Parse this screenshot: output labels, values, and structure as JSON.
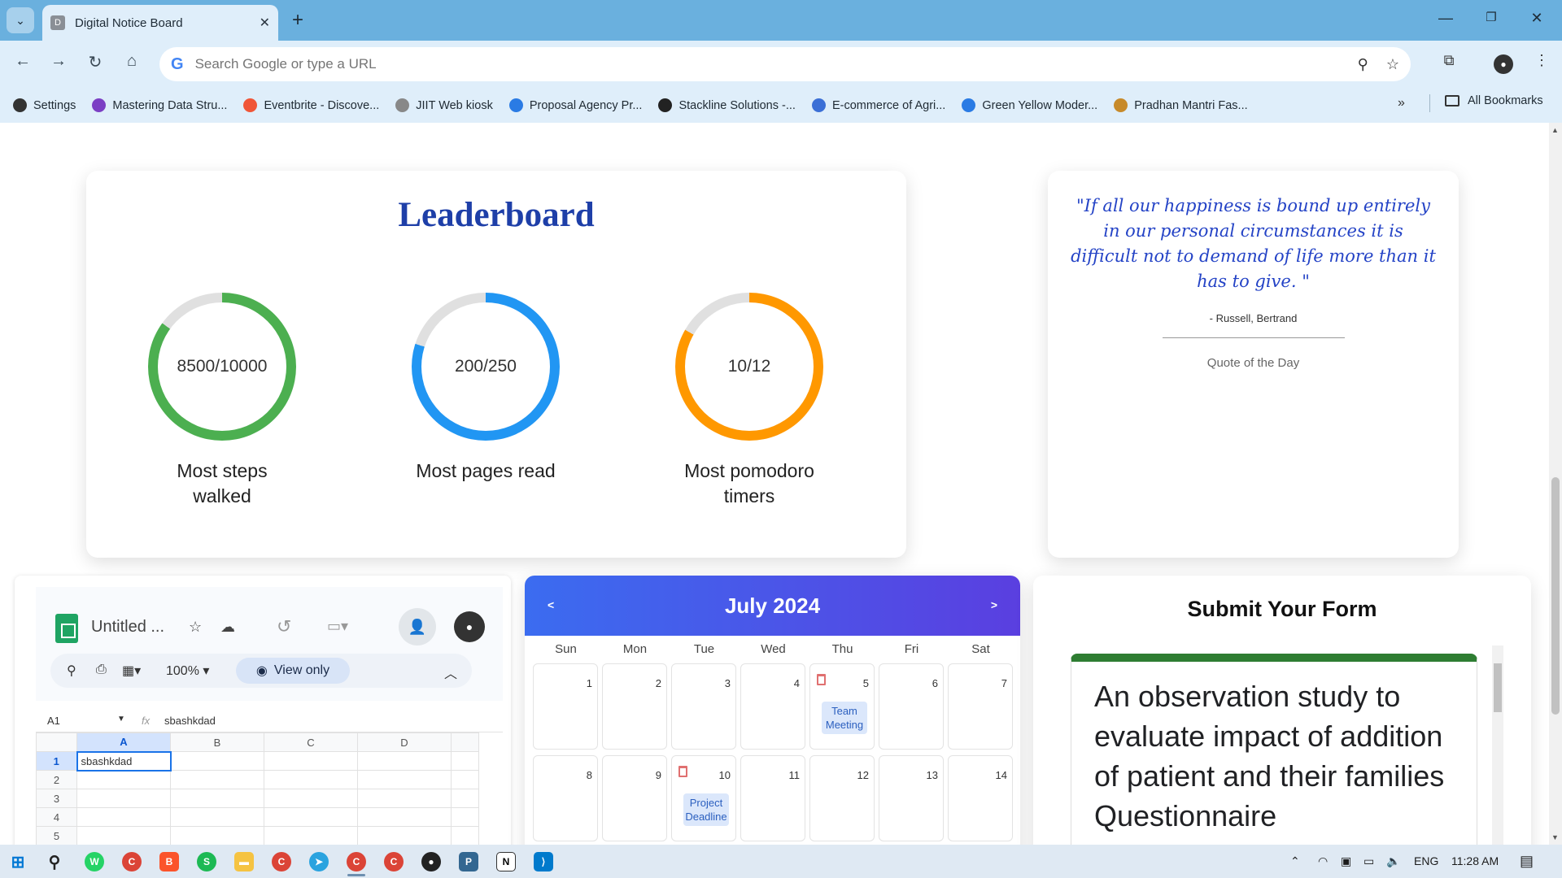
{
  "browser": {
    "tab_title": "Digital Notice Board",
    "tab_favicon": "D",
    "address_placeholder": "Search Google or type a URL",
    "bookmarks": [
      {
        "label": "Settings",
        "icon": "gear-icon",
        "color": "#333333"
      },
      {
        "label": "Mastering Data Stru...",
        "icon": "bookmark-icon",
        "color": "#7b3fc4"
      },
      {
        "label": "Eventbrite - Discove...",
        "icon": "eventbrite-icon",
        "color": "#f05537"
      },
      {
        "label": "JIIT Web kiosk",
        "icon": "kiosk-icon",
        "color": "#888888"
      },
      {
        "label": "Proposal Agency Pr...",
        "icon": "canva-icon",
        "color": "#2a7be4"
      },
      {
        "label": "Stackline Solutions -...",
        "icon": "s-icon",
        "color": "#222222"
      },
      {
        "label": "E-commerce of Agri...",
        "icon": "triangle-icon",
        "color": "#3b6fd6"
      },
      {
        "label": "Green Yellow Moder...",
        "icon": "canva-icon",
        "color": "#2a7be4"
      },
      {
        "label": "Pradhan Mantri Fas...",
        "icon": "emblem-icon",
        "color": "#c78a2a"
      }
    ],
    "all_bookmarks": "All Bookmarks"
  },
  "leaderboard": {
    "title": "Leaderboard",
    "items": [
      {
        "value_text": "8500/10000",
        "label": "Most steps walked",
        "progress": 0.85,
        "color": "#4caf50"
      },
      {
        "value_text": "200/250",
        "label": "Most pages read",
        "progress": 0.8,
        "color": "#2196f3"
      },
      {
        "value_text": "10/12",
        "label": "Most pomodoro timers",
        "progress": 0.833,
        "color": "#ff9800"
      }
    ]
  },
  "quote": {
    "text": "\"If all our happiness is bound up entirely in our personal circumstances it is difficult not to demand of life more than it has to give. \"",
    "author": "- Russell, Bertrand",
    "label": "Quote of the Day"
  },
  "sheet": {
    "title": "Untitled ...",
    "zoom": "100%",
    "view_mode": "View only",
    "cell_ref": "A1",
    "fx": "fx",
    "formula_value": "sbashkdad",
    "columns": [
      "A",
      "B",
      "C",
      "D"
    ],
    "rows": [
      "1",
      "2",
      "3",
      "4",
      "5"
    ],
    "a1_value": "sbashkdad"
  },
  "calendar": {
    "month": "July 2024",
    "prev": "<",
    "next": ">",
    "weekdays": [
      "Sun",
      "Mon",
      "Tue",
      "Wed",
      "Thu",
      "Fri",
      "Sat"
    ],
    "days": [
      {
        "n": "1"
      },
      {
        "n": "2"
      },
      {
        "n": "3"
      },
      {
        "n": "4"
      },
      {
        "n": "5",
        "event": "Team Meeting"
      },
      {
        "n": "6"
      },
      {
        "n": "7"
      },
      {
        "n": "8"
      },
      {
        "n": "9"
      },
      {
        "n": "10",
        "event": "Project Deadline"
      },
      {
        "n": "11"
      },
      {
        "n": "12"
      },
      {
        "n": "13"
      },
      {
        "n": "14"
      }
    ]
  },
  "form": {
    "heading": "Submit Your Form",
    "form_title": "An observation study to evaluate impact of addition of patient and their families Questionnaire",
    "accent": "#2e7d32"
  },
  "taskbar": {
    "language": "ENG",
    "time": "11:28 AM"
  }
}
